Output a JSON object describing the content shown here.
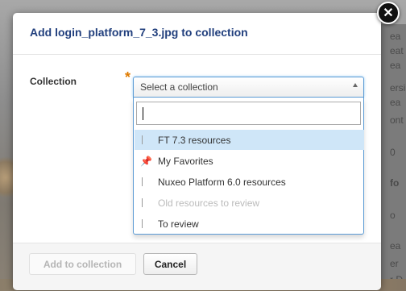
{
  "dialog": {
    "title": "Add login_platform_7_3.jpg to collection",
    "close_symbol": "✕"
  },
  "form": {
    "collection_label": "Collection",
    "required_marker": "*",
    "select_placeholder": "Select a collection",
    "search_value": "",
    "options": [
      {
        "label": "FT 7.3 resources",
        "icon": "book-icon",
        "state": "highlighted"
      },
      {
        "label": "My Favorites",
        "icon": "pin-icon",
        "state": "normal"
      },
      {
        "label": "Nuxeo Platform 6.0 resources",
        "icon": "book-icon",
        "state": "normal"
      },
      {
        "label": "Old resources to review",
        "icon": "book-icon",
        "state": "disabled"
      },
      {
        "label": "To review",
        "icon": "book-icon",
        "state": "normal"
      }
    ]
  },
  "footer": {
    "add_label": "Add to collection",
    "cancel_label": "Cancel"
  },
  "background": {
    "text_fragments": [
      "ea",
      "eat",
      "ea",
      "ersi",
      "ea",
      "ont",
      "0",
      "fo",
      "o",
      "ea",
      "er",
      "r D"
    ]
  }
}
